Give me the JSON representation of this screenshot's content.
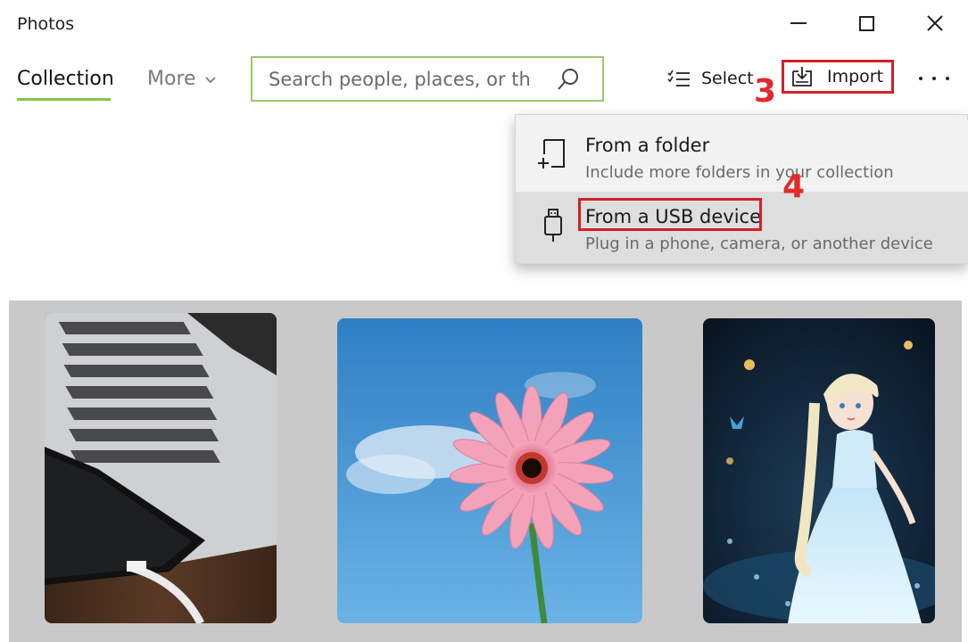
{
  "app": {
    "title": "Photos"
  },
  "nav": {
    "collection_label": "Collection",
    "more_label": "More"
  },
  "search": {
    "placeholder": "Search people, places, or th"
  },
  "toolbar": {
    "select_label": "Select",
    "import_label": "Import"
  },
  "annotations": {
    "step3": "3",
    "step4": "4"
  },
  "import_menu": {
    "items": [
      {
        "title": "From a folder",
        "subtitle": "Include more folders in your collection",
        "icon": "add-folder-icon"
      },
      {
        "title": "From a USB device",
        "subtitle": "Plug in a phone, camera, or another device",
        "icon": "usb-icon"
      }
    ]
  },
  "gallery": {
    "photos": [
      {
        "subject": "laptop-with-phone"
      },
      {
        "subject": "pink-daisy-flower"
      },
      {
        "subject": "ice-princess"
      }
    ]
  },
  "colors": {
    "accent_green": "#8bc34a",
    "highlight_red": "#d32027",
    "step_red": "#e12a2a",
    "gallery_bg": "#c9c9c9"
  }
}
